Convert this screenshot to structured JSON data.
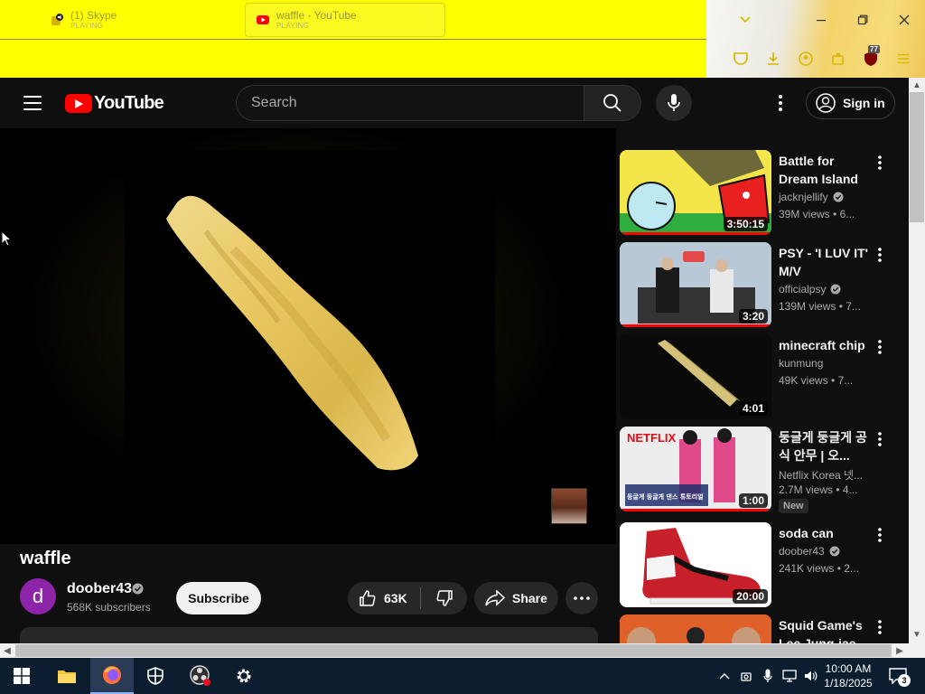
{
  "browser": {
    "tabs": [
      {
        "title": "(1) Skype",
        "status": "PLAYING",
        "icon": "skype-icon"
      },
      {
        "title": "waffle - YouTube",
        "status": "PLAYING",
        "icon": "youtube-icon"
      }
    ],
    "addon_badge": "77",
    "colors": {
      "toolbar": "#ffff00"
    }
  },
  "youtube": {
    "logo_text": "YouTube",
    "search_placeholder": "Search",
    "sign_in": "Sign in"
  },
  "video": {
    "title": "waffle",
    "channel": "doober43",
    "avatar_letter": "d",
    "subscribers": "568K subscribers",
    "subscribe_label": "Subscribe",
    "likes": "63K",
    "share_label": "Share"
  },
  "recommendations": [
    {
      "title": "Battle for Dream Island ...",
      "channel": "jacknjellify",
      "verified": true,
      "views": "39M views",
      "age": "6...",
      "duration": "3:50:15",
      "progress": 1.0
    },
    {
      "title": "PSY - 'I LUV IT' M/V",
      "channel": "officialpsy",
      "verified": true,
      "views": "139M views",
      "age": "7...",
      "duration": "3:20",
      "progress": 1.0
    },
    {
      "title": "minecraft chip",
      "channel": "kunmung",
      "verified": false,
      "views": "49K views",
      "age": "7...",
      "duration": "4:01",
      "progress": 0
    },
    {
      "title": "둥글게 둥글게 공식 안무 | 오...",
      "channel": "Netflix Korea 넷...",
      "verified": false,
      "views": "2.7M views",
      "age": "4...",
      "duration": "1:00",
      "badge": "New",
      "progress": 1.0,
      "thumb_text_top": "NETFLIX",
      "thumb_text_bottom": "둥글게 둥글게 댄스 튜토리얼"
    },
    {
      "title": "soda can",
      "channel": "doober43",
      "verified": true,
      "views": "241K views",
      "age": "2...",
      "duration": "20:00",
      "progress": 0
    },
    {
      "title": "Squid Game's Lee Jung-jae",
      "channel": "",
      "verified": false,
      "views": "",
      "age": "",
      "duration": "",
      "progress": 0
    }
  ],
  "taskbar": {
    "time": "10:00 AM",
    "date": "1/18/2025",
    "notifications": "3"
  }
}
